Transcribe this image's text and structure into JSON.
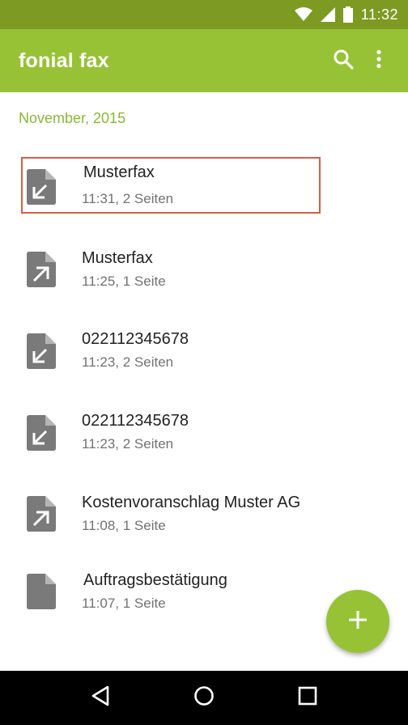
{
  "status_bar": {
    "time": "11:32"
  },
  "app_bar": {
    "title": "fonial fax",
    "actions": [
      "search-icon",
      "more-vert-icon"
    ]
  },
  "section_header": "November, 2015",
  "items": [
    {
      "name": "Musterfax",
      "meta": "11:31, 2 Seiten",
      "icon": "fax-incoming-icon",
      "selected": true
    },
    {
      "name": "Musterfax",
      "meta": "11:25, 1 Seite",
      "icon": "fax-outgoing-icon",
      "selected": false
    },
    {
      "name": "022112345678",
      "meta": "11:23, 2 Seiten",
      "icon": "fax-incoming-icon",
      "selected": false
    },
    {
      "name": "022112345678",
      "meta": "11:23, 2 Seiten",
      "icon": "fax-incoming-icon",
      "selected": false
    },
    {
      "name": "Kostenvoranschlag Muster AG",
      "meta": "11:08, 1 Seite",
      "icon": "fax-outgoing-icon",
      "selected": false
    },
    {
      "name": "Auftragsbestätigung",
      "meta": "11:07, 1 Seite",
      "icon": "fax-document-icon",
      "selected": false
    }
  ],
  "fab": {
    "icon": "add-icon"
  },
  "nav_bar": {
    "buttons": [
      "back-icon",
      "home-icon",
      "recents-icon"
    ]
  },
  "colors": {
    "status_bar": "#7d9a23",
    "app_bar": "#97c236",
    "accent": "#8ab931",
    "selection_border": "#d85f44",
    "icon_gray": "#7a7a7a"
  }
}
